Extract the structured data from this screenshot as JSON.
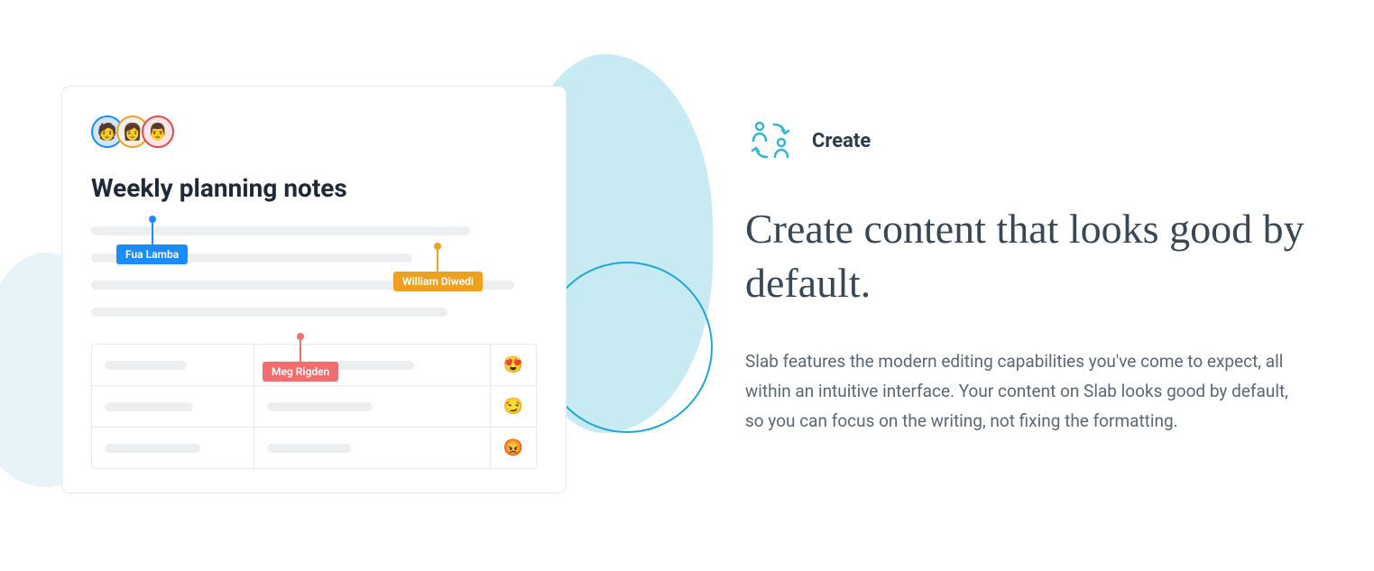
{
  "left": {
    "title": "Weekly planning notes",
    "cursors": [
      {
        "name": "Fua Lamba",
        "color": "blue"
      },
      {
        "name": "William Diwedi",
        "color": "yellow"
      },
      {
        "name": "Meg Rigden",
        "color": "red"
      }
    ],
    "table": {
      "rows": [
        {
          "emoji": "😍"
        },
        {
          "emoji": "😏"
        },
        {
          "emoji": "😡"
        }
      ]
    }
  },
  "right": {
    "section_label": "Create",
    "headline": "Create content that looks good by default.",
    "body": "Slab features the modern editing capabilities you've come to expect, all within an intuitive interface. Your content on Slab looks good by default, so you can focus on the writing, not fixing the formatting."
  }
}
